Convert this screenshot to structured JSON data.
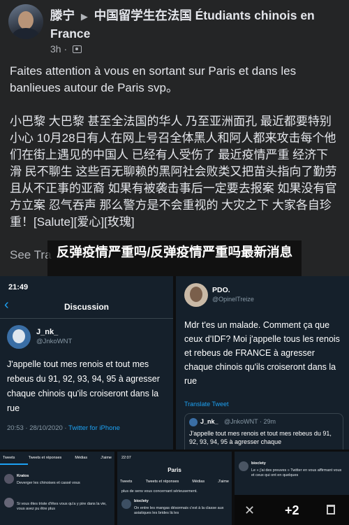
{
  "post": {
    "author": "滕宁",
    "arrow": "▶",
    "group": "中国留学生在法国 Étudiants chinois en France",
    "time": "3h ·",
    "text_fr": "Faites attention à vous en sortant sur Paris et dans les banlieues autour de Paris svp。",
    "text_zh": "小巴黎 大巴黎 甚至全法国的华人 乃至亚洲面孔 最近都要特别小心 10月28日有人在网上号召全体黑人和阿人都来攻击每个他们在街上遇见的中国人 已经有人受伤了 最近疫情严重 经济下滑 民不聊生 这些百无聊赖的黑阿社会败类又把苗头指向了勤劳且从不正事的亚裔 如果有被袭击事后一定要去报案 如果没有官方立案 忍气吞声 那么警方是不会重视的 大灾之下 大家各自珍重！[Salute][爱心][玫瑰]",
    "see_translation": "See Tra"
  },
  "overlay": {
    "title": "反弹疫情严重吗/反弹疫情严重吗最新消息"
  },
  "left_shot": {
    "time": "21:49",
    "back": "‹",
    "header": "Discussion",
    "name": "J_nk_",
    "handle": "@JnkoWNT",
    "tweet": "J'appelle tout mes renois et tout mes rebeus du 91, 92, 93, 94, 95 à agresser chaque chinois qu'ils croiseront dans la rue",
    "date": "20:53 · 28/10/2020 ·",
    "via": "Twitter for iPhone"
  },
  "right_shot": {
    "name": "PDO.",
    "handle": "@OpinelTreize",
    "tweet": "Mdr t'es un malade. Comment ça que ceux d'IDF? Moi j'appelle tous les renois et rebeus de FRANCE à agresser chaque chinois qu'ils croiseront dans la rue",
    "translate": "Translate Tweet",
    "quote_name": "J_nk_",
    "quote_handle": "@JnkoWNT · 29m",
    "quote_text": "J'appelle tout mes renois et tout mes rebeus du 91, 92, 93, 94, 95 à agresser chaque"
  },
  "thumb1": {
    "tabs": [
      "Tweets",
      "Tweets et réponses",
      "Médias",
      "J'aime"
    ],
    "l1": "Kratos",
    "l2": "Deverger les chinoises et cassé vous",
    "l3": "Si vous êtes triste d'êtes vous qu'a y pire dans la vie, vous avez pu être plus"
  },
  "thumb2": {
    "time": "22:07",
    "title": "Paris",
    "tabs": [
      "Tweets",
      "Tweets et réponses",
      "Médias",
      "J'aime"
    ],
    "l1": "plus de sens vous concernant sérieusement.",
    "l2": "bioclety",
    "l3": "On entre les mangas désormais c'est à la classe aux asiatiques les brides là les"
  },
  "thumb3": {
    "l1": "bioclety",
    "l2": "Le « j'ai des preuves » Twitter en vous affirmant vous et ceux qui ont en quelques",
    "count": "+2"
  },
  "colors": {
    "fb_bg": "#242526",
    "tw_bg": "#15202b",
    "link": "#1da1f2"
  }
}
